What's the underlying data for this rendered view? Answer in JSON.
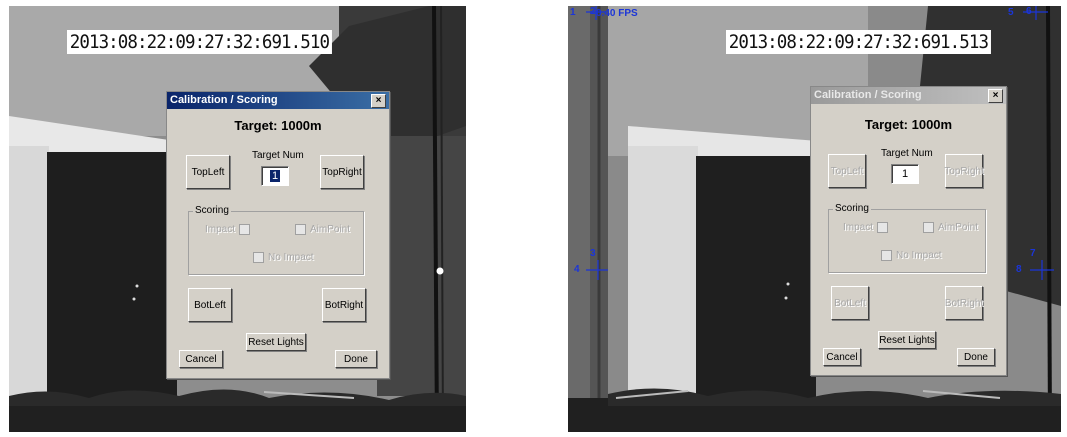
{
  "left": {
    "timestamp": "2013:08:22:09:27:32:691.510",
    "dialog": {
      "title": "Calibration / Scoring",
      "close": "×",
      "target": "Target: 1000m",
      "target_num_label": "Target Num",
      "target_num_value": "1",
      "top_left": "TopLeft",
      "top_right": "TopRight",
      "scoring_label": "Scoring",
      "impact": "Impact",
      "aimpoint": "AimPoint",
      "no_impact": "No Impact",
      "bot_left": "BotLeft",
      "bot_right": "BotRight",
      "reset_lights": "Reset Lights",
      "cancel": "Cancel",
      "done": "Done"
    }
  },
  "right": {
    "timestamp": "2013:08:22:09:27:32:691.513",
    "fps": "0.40 FPS",
    "markers": {
      "m1": "1",
      "m2": "2",
      "m3": "3",
      "m4": "4",
      "m5": "5",
      "m6": "6",
      "m7": "7",
      "m8": "8"
    },
    "dialog": {
      "title": "Calibration / Scoring",
      "close": "×",
      "target": "Target: 1000m",
      "target_num_label": "Target Num",
      "target_num_value": "1",
      "top_left": "TopLeft",
      "top_right": "TopRight",
      "scoring_label": "Scoring",
      "impact": "Impact",
      "aimpoint": "AimPoint",
      "no_impact": "No Impact",
      "bot_left": "BotLeft",
      "bot_right": "BotRight",
      "reset_lights": "Reset Lights",
      "cancel": "Cancel",
      "done": "Done"
    }
  },
  "colors": {
    "overlay": "#1b35d8",
    "dialog_bg": "#d4d0c8",
    "titlebar_active": "#0a246a"
  }
}
